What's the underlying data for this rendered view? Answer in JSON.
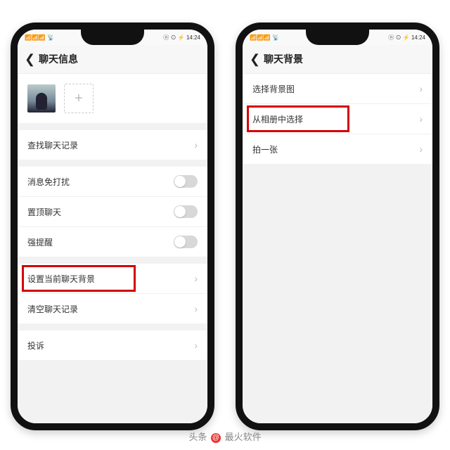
{
  "statusbar": {
    "left": "📶📶📶 📡",
    "right": "ⓝ ⊙ ⚡ 14:24"
  },
  "phone1": {
    "title": "聊天信息",
    "rows": {
      "search_history": "查找聊天记录",
      "mute": "消息免打扰",
      "pin": "置顶聊天",
      "strong_alert": "强提醒",
      "set_bg": "设置当前聊天背景",
      "clear_history": "清空聊天记录",
      "complaint": "投诉"
    }
  },
  "phone2": {
    "title": "聊天背景",
    "rows": {
      "choose_bg": "选择背景图",
      "from_album": "从相册中选择",
      "take_photo": "拍一张"
    }
  },
  "watermark": {
    "prefix": "头条",
    "at": "@",
    "name": "最火软件"
  }
}
